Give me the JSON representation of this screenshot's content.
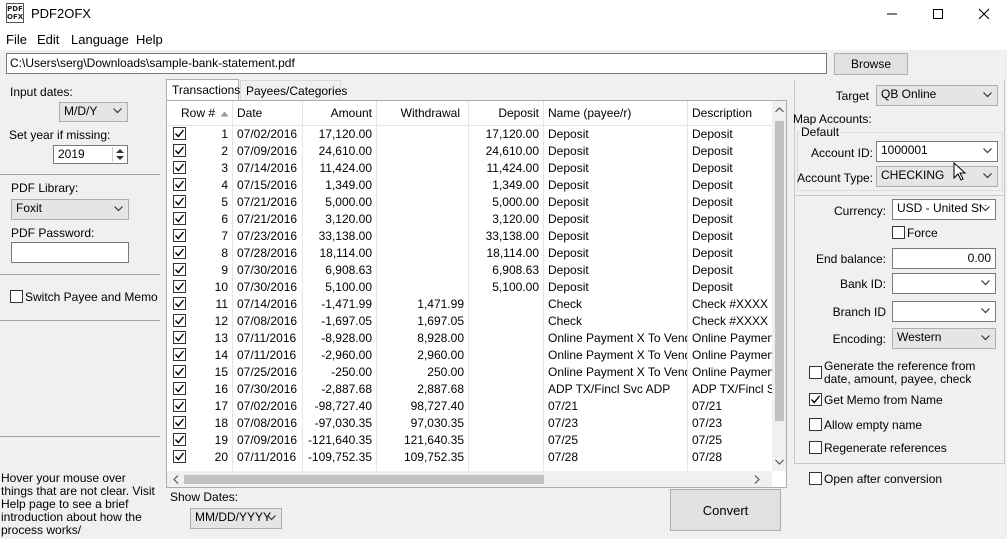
{
  "window": {
    "title": "PDF2OFX",
    "icon_text": "PDF OFX"
  },
  "menu": [
    "File",
    "Edit",
    "Language",
    "Help"
  ],
  "file_path": "C:\\Users\\serg\\Downloads\\sample-bank-statement.pdf",
  "browse_label": "Browse",
  "left": {
    "input_dates_label": "Input dates:",
    "input_dates_value": "M/D/Y",
    "set_year_label": "Set year if missing:",
    "year_value": "2019",
    "pdf_library_label": "PDF Library:",
    "pdf_library_value": "Foxit",
    "pdf_password_label": "PDF Password:",
    "pdf_password_value": "",
    "switch_label": "Switch Payee and Memo",
    "switch_checked": false,
    "help_text": "Hover your mouse over things that are not clear. Visit Help page to see a brief introduction about how the process works/"
  },
  "tabs": [
    {
      "label": "Transactions",
      "active": true
    },
    {
      "label": "Payees/Categories",
      "active": false
    }
  ],
  "table": {
    "columns": [
      "Row #",
      "Date",
      "Amount",
      "Withdrawal",
      "Deposit",
      "Name (payee/r)",
      "Description"
    ],
    "rows": [
      {
        "checked": true,
        "row": "1",
        "date": "07/02/2016",
        "amount": "17,120.00",
        "withdrawal": "",
        "deposit": "17,120.00",
        "name": "Deposit",
        "desc": "Deposit"
      },
      {
        "checked": true,
        "row": "2",
        "date": "07/09/2016",
        "amount": "24,610.00",
        "withdrawal": "",
        "deposit": "24,610.00",
        "name": "Deposit",
        "desc": "Deposit"
      },
      {
        "checked": true,
        "row": "3",
        "date": "07/14/2016",
        "amount": "11,424.00",
        "withdrawal": "",
        "deposit": "11,424.00",
        "name": "Deposit",
        "desc": "Deposit"
      },
      {
        "checked": true,
        "row": "4",
        "date": "07/15/2016",
        "amount": "1,349.00",
        "withdrawal": "",
        "deposit": "1,349.00",
        "name": "Deposit",
        "desc": "Deposit"
      },
      {
        "checked": true,
        "row": "5",
        "date": "07/21/2016",
        "amount": "5,000.00",
        "withdrawal": "",
        "deposit": "5,000.00",
        "name": "Deposit",
        "desc": "Deposit"
      },
      {
        "checked": true,
        "row": "6",
        "date": "07/21/2016",
        "amount": "3,120.00",
        "withdrawal": "",
        "deposit": "3,120.00",
        "name": "Deposit",
        "desc": "Deposit"
      },
      {
        "checked": true,
        "row": "7",
        "date": "07/23/2016",
        "amount": "33,138.00",
        "withdrawal": "",
        "deposit": "33,138.00",
        "name": "Deposit",
        "desc": "Deposit"
      },
      {
        "checked": true,
        "row": "8",
        "date": "07/28/2016",
        "amount": "18,114.00",
        "withdrawal": "",
        "deposit": "18,114.00",
        "name": "Deposit",
        "desc": "Deposit"
      },
      {
        "checked": true,
        "row": "9",
        "date": "07/30/2016",
        "amount": "6,908.63",
        "withdrawal": "",
        "deposit": "6,908.63",
        "name": "Deposit",
        "desc": "Deposit"
      },
      {
        "checked": true,
        "row": "10",
        "date": "07/30/2016",
        "amount": "5,100.00",
        "withdrawal": "",
        "deposit": "5,100.00",
        "name": "Deposit",
        "desc": "Deposit"
      },
      {
        "checked": true,
        "row": "11",
        "date": "07/14/2016",
        "amount": "-1,471.99",
        "withdrawal": "1,471.99",
        "deposit": "",
        "name": "Check",
        "desc": "Check #XXXX"
      },
      {
        "checked": true,
        "row": "12",
        "date": "07/08/2016",
        "amount": "-1,697.05",
        "withdrawal": "1,697.05",
        "deposit": "",
        "name": "Check",
        "desc": "Check #XXXX"
      },
      {
        "checked": true,
        "row": "13",
        "date": "07/11/2016",
        "amount": "-8,928.00",
        "withdrawal": "8,928.00",
        "deposit": "",
        "name": "Online Payment X To Vendor",
        "desc": "Online Payment"
      },
      {
        "checked": true,
        "row": "14",
        "date": "07/11/2016",
        "amount": "-2,960.00",
        "withdrawal": "2,960.00",
        "deposit": "",
        "name": "Online Payment X To Vendor",
        "desc": "Online Payment"
      },
      {
        "checked": true,
        "row": "15",
        "date": "07/25/2016",
        "amount": "-250.00",
        "withdrawal": "250.00",
        "deposit": "",
        "name": "Online Payment X To Vendor",
        "desc": "Online Payment"
      },
      {
        "checked": true,
        "row": "16",
        "date": "07/30/2016",
        "amount": "-2,887.68",
        "withdrawal": "2,887.68",
        "deposit": "",
        "name": "ADP TX/Fincl Svc ADP",
        "desc": "ADP TX/Fincl Svc"
      },
      {
        "checked": true,
        "row": "17",
        "date": "07/02/2016",
        "amount": "-98,727.40",
        "withdrawal": "98,727.40",
        "deposit": "",
        "name": "07/21",
        "desc": "07/21"
      },
      {
        "checked": true,
        "row": "18",
        "date": "07/08/2016",
        "amount": "-97,030.35",
        "withdrawal": "97,030.35",
        "deposit": "",
        "name": "07/23",
        "desc": "07/23"
      },
      {
        "checked": true,
        "row": "19",
        "date": "07/09/2016",
        "amount": "-121,640.35",
        "withdrawal": "121,640.35",
        "deposit": "",
        "name": "07/25",
        "desc": "07/25"
      },
      {
        "checked": true,
        "row": "20",
        "date": "07/11/2016",
        "amount": "-109,752.35",
        "withdrawal": "109,752.35",
        "deposit": "",
        "name": "07/28",
        "desc": "07/28"
      }
    ]
  },
  "bottom": {
    "show_dates_label": "Show Dates:",
    "show_dates_value": "MM/DD/YYYY",
    "convert_label": "Convert"
  },
  "right": {
    "target_label": "Target",
    "target_value": "QB Online",
    "map_accounts_label": "Map Accounts:",
    "default_label": "Default",
    "account_id_label": "Account ID:",
    "account_id_value": "1000001",
    "account_type_label": "Account Type:",
    "account_type_value": "CHECKING",
    "currency_label": "Currency:",
    "currency_value": "USD - United Sta",
    "force_label": "Force",
    "force_checked": false,
    "end_balance_label": "End balance:",
    "end_balance_value": "0.00",
    "bank_id_label": "Bank ID:",
    "bank_id_value": "",
    "branch_id_label": "Branch ID",
    "branch_id_value": "",
    "encoding_label": "Encoding:",
    "encoding_value": "Western",
    "gen_ref_label": "Generate the reference from date, amount, payee, check",
    "gen_ref_checked": false,
    "get_memo_label": "Get Memo from Name",
    "get_memo_checked": true,
    "allow_empty_label": "Allow empty name",
    "allow_empty_checked": false,
    "regen_label": "Regenerate references",
    "regen_checked": false,
    "open_after_label": "Open after conversion",
    "open_after_checked": false
  }
}
